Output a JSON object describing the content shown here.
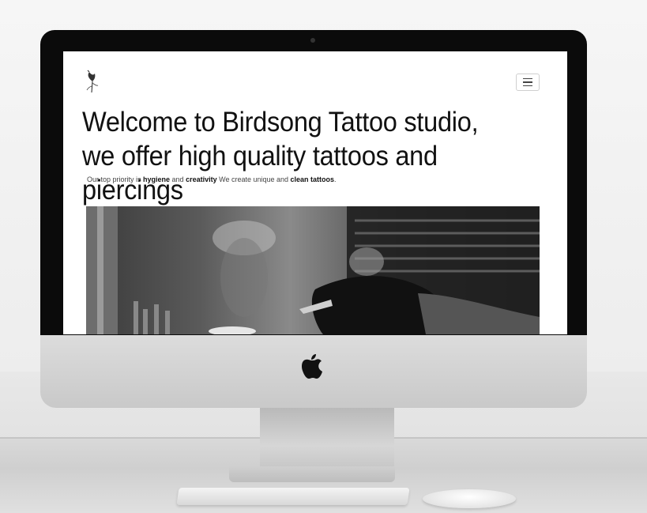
{
  "site": {
    "headline_line1": "Welcome to Birdsong Tattoo studio,",
    "headline_line2": "we offer high quality tattoos and piercings",
    "tagline": {
      "part1": "Our top priority is ",
      "bold1": "hygiene",
      "part2": " and ",
      "bold2": "creativity",
      "part3": " We create unique and ",
      "bold3": "clean tattoos",
      "part4": "."
    }
  },
  "icons": {
    "logo": "bird-logo-icon",
    "menu": "hamburger-menu-icon",
    "brand": "apple-logo-icon"
  }
}
